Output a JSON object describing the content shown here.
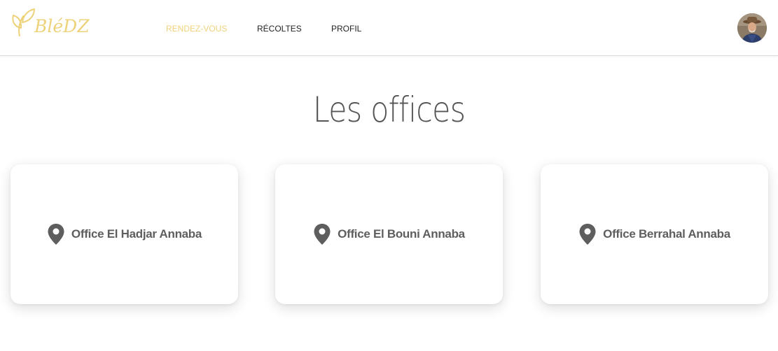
{
  "brand": {
    "name": "BléDZ",
    "accent_color": "#eed27a",
    "logo_icon": "leaf-icon"
  },
  "nav": {
    "items": [
      {
        "label": "RENDEZ-VOUS",
        "active": true
      },
      {
        "label": "RÉCOLTES",
        "active": false
      },
      {
        "label": "PROFIL",
        "active": false
      }
    ]
  },
  "user": {
    "avatar_icon": "user-avatar-icon"
  },
  "main": {
    "title": "Les offices",
    "offices": [
      {
        "label": "Office El Hadjar Annaba",
        "icon": "location-pin-icon"
      },
      {
        "label": "Office El Bouni Annaba",
        "icon": "location-pin-icon"
      },
      {
        "label": "Office Berrahal Annaba",
        "icon": "location-pin-icon"
      }
    ]
  }
}
